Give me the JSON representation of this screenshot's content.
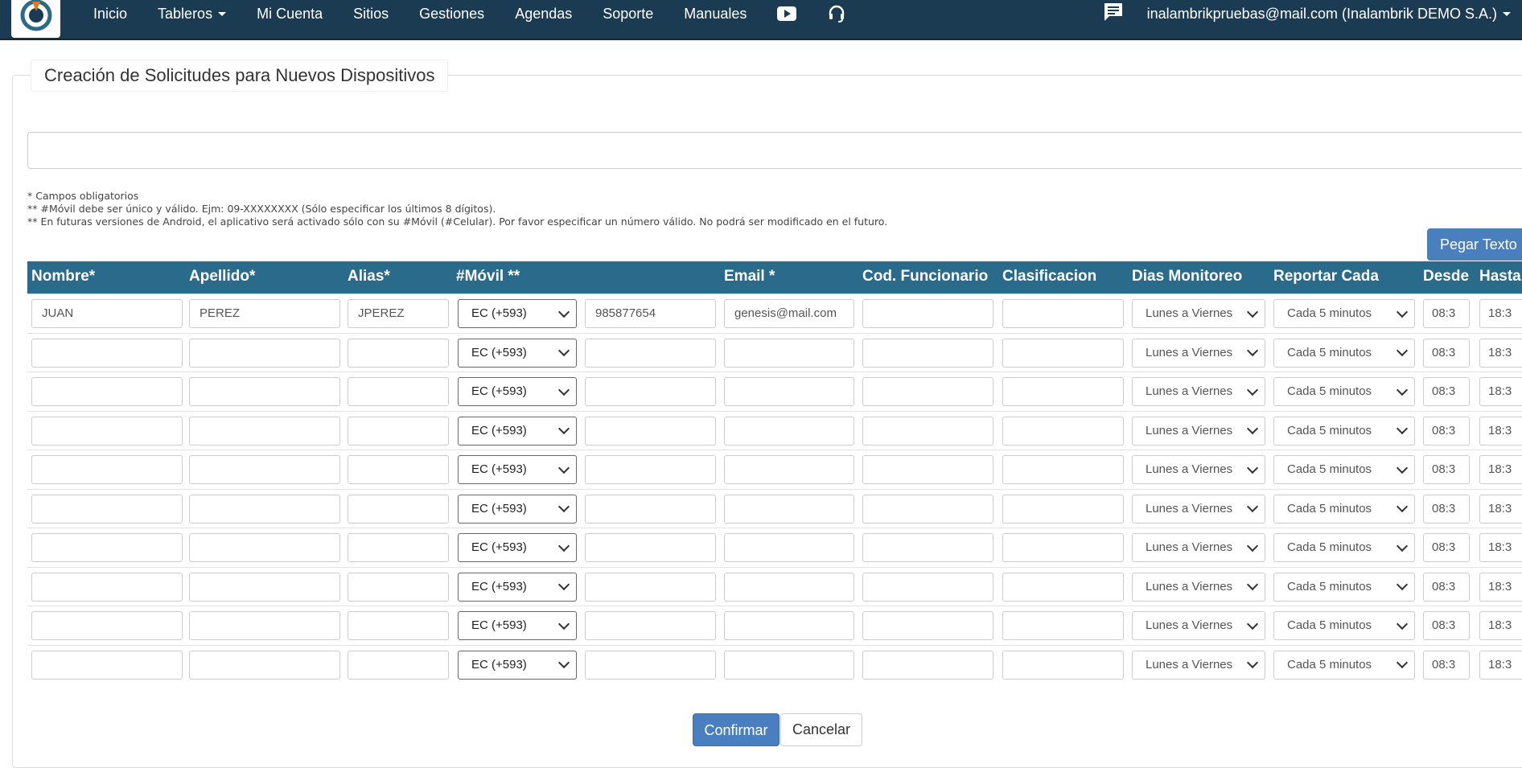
{
  "nav": {
    "items": [
      "Inicio",
      "Tableros",
      "Mi Cuenta",
      "Sitios",
      "Gestiones",
      "Agendas",
      "Soporte",
      "Manuales"
    ],
    "user": "inalambrikpruebas@mail.com (Inalambrik DEMO S.A.)"
  },
  "page": {
    "title": "Creación de Solicitudes para Nuevos Dispositivos",
    "notes": [
      "* Campos obligatorios",
      "** #Móvil debe ser único y válido. Ejm: 09-XXXXXXXX (Sólo especificar los últimos 8 dígitos).",
      "** En futuras versiones de Android, el aplicativo será activado sólo con su #Móvil (#Celular). Por favor especificar un número válido. No podrá ser modificado en el futuro."
    ],
    "paste_label": "Pegar Texto"
  },
  "table": {
    "headers": [
      "Nombre*",
      "Apellido*",
      "Alias*",
      "#Móvil **",
      "Email *",
      "Cod. Funcionario",
      "Clasificacion",
      "Dias Monitoreo",
      "Reportar Cada",
      "Desde",
      "Hasta"
    ],
    "rows": [
      {
        "nombre": "JUAN",
        "apellido": "PEREZ",
        "alias": "JPEREZ",
        "pais": "EC (+593)",
        "movil": "985877654",
        "email": "genesis@mail.com",
        "cod": "",
        "clasif": "",
        "dias": "Lunes a Viernes",
        "reportar": "Cada 5 minutos",
        "desde": "08:3",
        "hasta": "18:3"
      },
      {
        "nombre": "",
        "apellido": "",
        "alias": "",
        "pais": "EC (+593)",
        "movil": "",
        "email": "",
        "cod": "",
        "clasif": "",
        "dias": "Lunes a Viernes",
        "reportar": "Cada 5 minutos",
        "desde": "08:3",
        "hasta": "18:3"
      },
      {
        "nombre": "",
        "apellido": "",
        "alias": "",
        "pais": "EC (+593)",
        "movil": "",
        "email": "",
        "cod": "",
        "clasif": "",
        "dias": "Lunes a Viernes",
        "reportar": "Cada 5 minutos",
        "desde": "08:3",
        "hasta": "18:3"
      },
      {
        "nombre": "",
        "apellido": "",
        "alias": "",
        "pais": "EC (+593)",
        "movil": "",
        "email": "",
        "cod": "",
        "clasif": "",
        "dias": "Lunes a Viernes",
        "reportar": "Cada 5 minutos",
        "desde": "08:3",
        "hasta": "18:3"
      },
      {
        "nombre": "",
        "apellido": "",
        "alias": "",
        "pais": "EC (+593)",
        "movil": "",
        "email": "",
        "cod": "",
        "clasif": "",
        "dias": "Lunes a Viernes",
        "reportar": "Cada 5 minutos",
        "desde": "08:3",
        "hasta": "18:3"
      },
      {
        "nombre": "",
        "apellido": "",
        "alias": "",
        "pais": "EC (+593)",
        "movil": "",
        "email": "",
        "cod": "",
        "clasif": "",
        "dias": "Lunes a Viernes",
        "reportar": "Cada 5 minutos",
        "desde": "08:3",
        "hasta": "18:3"
      },
      {
        "nombre": "",
        "apellido": "",
        "alias": "",
        "pais": "EC (+593)",
        "movil": "",
        "email": "",
        "cod": "",
        "clasif": "",
        "dias": "Lunes a Viernes",
        "reportar": "Cada 5 minutos",
        "desde": "08:3",
        "hasta": "18:3"
      },
      {
        "nombre": "",
        "apellido": "",
        "alias": "",
        "pais": "EC (+593)",
        "movil": "",
        "email": "",
        "cod": "",
        "clasif": "",
        "dias": "Lunes a Viernes",
        "reportar": "Cada 5 minutos",
        "desde": "08:3",
        "hasta": "18:3"
      },
      {
        "nombre": "",
        "apellido": "",
        "alias": "",
        "pais": "EC (+593)",
        "movil": "",
        "email": "",
        "cod": "",
        "clasif": "",
        "dias": "Lunes a Viernes",
        "reportar": "Cada 5 minutos",
        "desde": "08:3",
        "hasta": "18:3"
      },
      {
        "nombre": "",
        "apellido": "",
        "alias": "",
        "pais": "EC (+593)",
        "movil": "",
        "email": "",
        "cod": "",
        "clasif": "",
        "dias": "Lunes a Viernes",
        "reportar": "Cada 5 minutos",
        "desde": "08:3",
        "hasta": "18:3"
      }
    ]
  },
  "actions": {
    "confirm": "Confirmar",
    "cancel": "Cancelar"
  },
  "colors": {
    "navbar": "#1b3b52",
    "table_header": "#2a6a8a",
    "primary": "#4a7fbf"
  }
}
